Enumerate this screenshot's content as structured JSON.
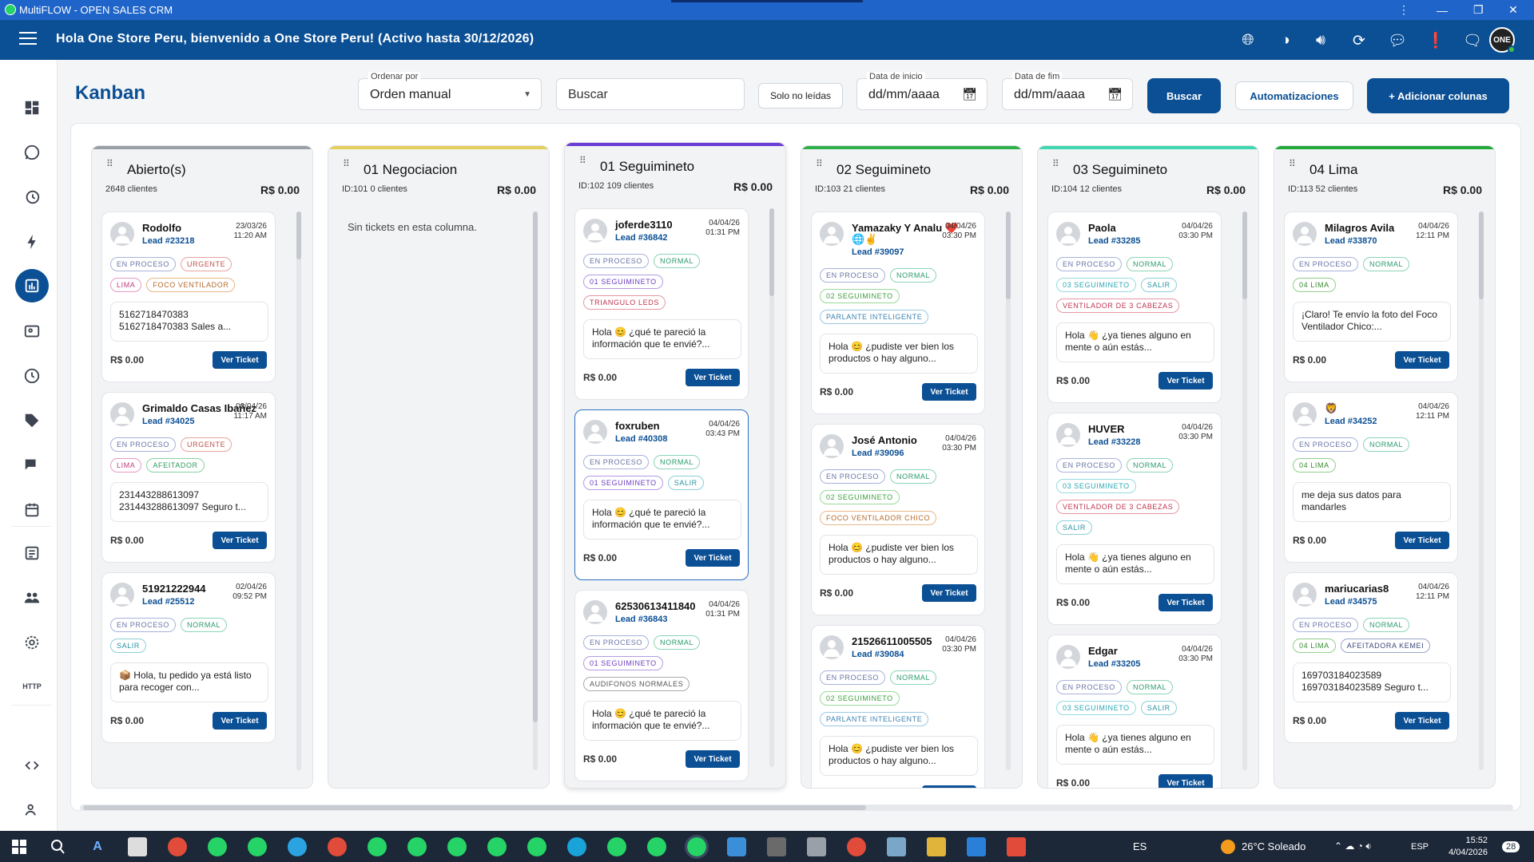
{
  "window": {
    "title": "MultiFLOW - OPEN SALES CRM"
  },
  "header": {
    "welcome": "Hola One Store Peru, bienvenido a One Store Peru! (Activo hasta 30/12/2026)",
    "avatar_initials": "ONE"
  },
  "page": {
    "title": "Kanban"
  },
  "toolbar": {
    "order_label": "Ordenar por",
    "order_value": "Orden manual",
    "search_placeholder": "Buscar",
    "unread_label": "Solo no leídas",
    "start_label": "Data de inicio",
    "start_value": "dd/mm/aaaa",
    "end_label": "Data de fim",
    "end_value": "dd/mm/aaaa",
    "search_btn": "Buscar",
    "auto_btn": "Automatizaciones",
    "add_btn": "+ Adicionar colunas"
  },
  "labels": {
    "ver_ticket": "Ver Ticket"
  },
  "columns": [
    {
      "title": "Abierto(s)",
      "meta": "2648 clientes",
      "amount": "R$ 0.00",
      "color": "#9aa0a8",
      "cards": [
        {
          "name": "Rodolfo",
          "lead": "Lead #23218",
          "date": "23/03/26",
          "time": "11:20 AM",
          "tags1": [
            "EN PROCESO",
            "URGENTE"
          ],
          "tags2": [
            "LIMA",
            "FOCO VENTILADOR"
          ],
          "msg": "5162718470383 5162718470383 Sales a...",
          "amount": "R$ 0.00"
        },
        {
          "name": "Grimaldo Casas Ibañez",
          "lead": "Lead #34025",
          "date": "02/04/26",
          "time": "11:17 AM",
          "tags1": [
            "EN PROCESO",
            "URGENTE"
          ],
          "tags2": [
            "LIMA",
            "AFEITADOR"
          ],
          "msg": "231443288613097 231443288613097 Seguro t...",
          "amount": "R$ 0.00"
        },
        {
          "name": "51921222944",
          "lead": "Lead #25512",
          "date": "02/04/26",
          "time": "09:52 PM",
          "tags1": [
            "EN PROCESO",
            "NORMAL"
          ],
          "tags2": [
            "SALIR"
          ],
          "msg": "📦 Hola, tu pedido ya está listo para recoger con...",
          "amount": "R$ 0.00"
        }
      ]
    },
    {
      "title": "01 Negociacion",
      "meta": "ID:101   0 clientes",
      "amount": "R$ 0.00",
      "color": "#e3cf5a",
      "empty": "Sin tickets en esta columna."
    },
    {
      "title": "01 Seguimineto",
      "meta": "ID:102   109 clientes",
      "amount": "R$ 0.00",
      "color": "#6b3fd6",
      "cards": [
        {
          "name": "joferde3110",
          "lead": "Lead #36842",
          "date": "04/04/26",
          "time": "01:31 PM",
          "tags1": [
            "EN PROCESO",
            "NORMAL"
          ],
          "tags2": [
            "01 SEGUIMINETO"
          ],
          "tags3": [
            "TRIANGULO LEDS"
          ],
          "msg": "Hola 😊 ¿qué te pareció la información que te envié?...",
          "amount": "R$ 0.00"
        },
        {
          "name": "foxruben",
          "lead": "Lead #40308",
          "date": "04/04/26",
          "time": "03:43 PM",
          "tags1": [
            "EN PROCESO",
            "NORMAL"
          ],
          "tags2": [
            "01 SEGUIMINETO",
            "SALIR"
          ],
          "msg": "Hola 😊 ¿qué te pareció la información que te envié?...",
          "amount": "R$ 0.00"
        },
        {
          "name": "62530613411840",
          "lead": "Lead #36843",
          "date": "04/04/26",
          "time": "01:31 PM",
          "tags1": [
            "EN PROCESO",
            "NORMAL"
          ],
          "tags2": [
            "01 SEGUIMINETO"
          ],
          "tags3": [
            "AUDIFONOS NORMALES"
          ],
          "msg": "Hola 😊 ¿qué te pareció la información que te envié?...",
          "amount": "R$ 0.00"
        }
      ]
    },
    {
      "title": "02 Seguimineto",
      "meta": "ID:103   21 clientes",
      "amount": "R$ 0.00",
      "color": "#2fb04a",
      "cards": [
        {
          "name": "Yamazaky Y Analu ❤️",
          "name2": "🌐✌️",
          "lead": "Lead #39097",
          "date": "04/04/26",
          "time": "03:30 PM",
          "tags1": [
            "EN PROCESO",
            "NORMAL"
          ],
          "tags2": [
            "02 SEGUIMINETO"
          ],
          "tags3": [
            "PARLANTE INTELIGENTE"
          ],
          "msg": "Hola 😊 ¿pudiste ver bien los productos o hay alguno...",
          "amount": "R$ 0.00"
        },
        {
          "name": "José Antonio",
          "lead": "Lead #39096",
          "date": "04/04/26",
          "time": "03:30 PM",
          "tags1": [
            "EN PROCESO",
            "NORMAL"
          ],
          "tags2": [
            "02 SEGUIMINETO"
          ],
          "tags3": [
            "FOCO VENTILADOR CHICO"
          ],
          "msg": "Hola 😊 ¿pudiste ver bien los productos o hay alguno...",
          "amount": "R$ 0.00"
        },
        {
          "name": "21526611005505",
          "lead": "Lead #39084",
          "date": "04/04/26",
          "time": "03:30 PM",
          "tags1": [
            "EN PROCESO",
            "NORMAL"
          ],
          "tags2": [
            "02 SEGUIMINETO"
          ],
          "tags3": [
            "PARLANTE INTELIGENTE"
          ],
          "msg": "Hola 😊 ¿pudiste ver bien los productos o hay alguno...",
          "amount": "R$ 0.00"
        }
      ]
    },
    {
      "title": "03 Seguimineto",
      "meta": "ID:104   12 clientes",
      "amount": "R$ 0.00",
      "color": "#3fd6b0",
      "cards": [
        {
          "name": "Paola",
          "lead": "Lead #33285",
          "date": "04/04/26",
          "time": "03:30 PM",
          "tags1": [
            "EN PROCESO",
            "NORMAL"
          ],
          "tags2": [
            "03 SEGUIMINETO",
            "SALIR"
          ],
          "tags3": [
            "VENTILADOR DE 3 CABEZAS"
          ],
          "msg": "Hola 👋 ¿ya tienes alguno en mente o aún estás...",
          "amount": "R$ 0.00"
        },
        {
          "name": "HUVER",
          "lead": "Lead #33228",
          "date": "04/04/26",
          "time": "03:30 PM",
          "tags1": [
            "EN PROCESO",
            "NORMAL"
          ],
          "tags2": [
            "03 SEGUIMINETO"
          ],
          "tags3": [
            "VENTILADOR DE 3 CABEZAS"
          ],
          "tags4": [
            "SALIR"
          ],
          "msg": "Hola 👋 ¿ya tienes alguno en mente o aún estás...",
          "amount": "R$ 0.00"
        },
        {
          "name": "Edgar",
          "lead": "Lead #33205",
          "date": "04/04/26",
          "time": "03:30 PM",
          "tags1": [
            "EN PROCESO",
            "NORMAL"
          ],
          "tags2": [
            "03 SEGUIMINETO",
            "SALIR"
          ],
          "msg": "Hola 👋 ¿ya tienes alguno en mente o aún estás...",
          "amount": "R$ 0.00"
        }
      ]
    },
    {
      "title": "04 Lima",
      "meta": "ID:113   52 clientes",
      "amount": "R$ 0.00",
      "color": "#23a83c",
      "cards": [
        {
          "name": "Milagros Avila",
          "lead": "Lead #33870",
          "date": "04/04/26",
          "time": "12:11 PM",
          "tags1": [
            "EN PROCESO",
            "NORMAL"
          ],
          "tags2": [
            "04 LIMA"
          ],
          "msg": "¡Claro! Te envío la foto del Foco Ventilador Chico:...",
          "amount": "R$ 0.00"
        },
        {
          "name": "🦁",
          "lead": "Lead #34252",
          "date": "04/04/26",
          "time": "12:11 PM",
          "tags1": [
            "EN PROCESO",
            "NORMAL"
          ],
          "tags2": [
            "04 LIMA"
          ],
          "msg": "me deja sus datos para mandarles",
          "amount": "R$ 0.00"
        },
        {
          "name": "mariucarias8",
          "lead": "Lead #34575",
          "date": "04/04/26",
          "time": "12:11 PM",
          "tags1": [
            "EN PROCESO",
            "NORMAL"
          ],
          "tags2": [
            "04 LIMA",
            "AFEITADORA KEMEI"
          ],
          "msg": "169703184023589 169703184023589 Seguro t...",
          "amount": "R$ 0.00"
        }
      ]
    }
  ],
  "taskbar": {
    "lang": "ES",
    "weather": "26°C  Soleado",
    "ime": "ESP",
    "time": "15:52",
    "date": "4/04/2026",
    "notif": "28"
  }
}
